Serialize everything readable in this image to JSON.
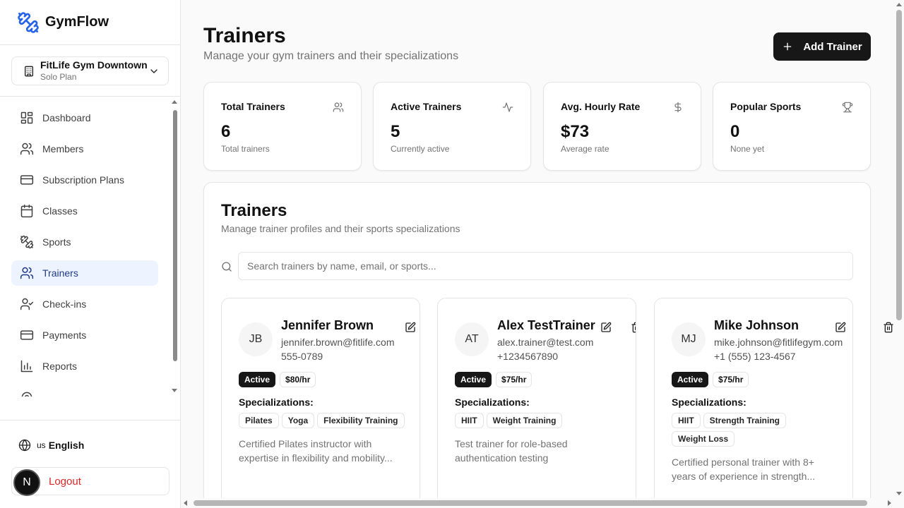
{
  "app": {
    "name": "GymFlow"
  },
  "gym_selector": {
    "name": "FitLife Gym Downtown",
    "plan": "Solo Plan"
  },
  "sidebar": {
    "items": [
      {
        "label": "Dashboard",
        "icon": "dashboard-icon"
      },
      {
        "label": "Members",
        "icon": "users-icon"
      },
      {
        "label": "Subscription Plans",
        "icon": "credit-card-icon"
      },
      {
        "label": "Classes",
        "icon": "calendar-icon"
      },
      {
        "label": "Sports",
        "icon": "dumbbell-icon"
      },
      {
        "label": "Trainers",
        "icon": "users-icon",
        "active": true
      },
      {
        "label": "Check-ins",
        "icon": "user-check-icon"
      },
      {
        "label": "Payments",
        "icon": "credit-card-icon"
      },
      {
        "label": "Reports",
        "icon": "bar-chart-icon"
      }
    ],
    "language": {
      "code": "us",
      "name": "English"
    },
    "logout_label": "Logout",
    "avatar_initial": "N"
  },
  "header": {
    "title": "Trainers",
    "subtitle": "Manage your gym trainers and their specializations",
    "add_button_label": "Add Trainer"
  },
  "stats": [
    {
      "title": "Total Trainers",
      "value": "6",
      "desc": "Total trainers",
      "icon": "users-icon"
    },
    {
      "title": "Active Trainers",
      "value": "5",
      "desc": "Currently active",
      "icon": "activity-icon"
    },
    {
      "title": "Avg. Hourly Rate",
      "value": "$73",
      "desc": "Average rate",
      "icon": "dollar-icon"
    },
    {
      "title": "Popular Sports",
      "value": "0",
      "desc": "None yet",
      "icon": "trophy-icon"
    }
  ],
  "panel": {
    "title": "Trainers",
    "subtitle": "Manage trainer profiles and their sports specializations",
    "search_placeholder": "Search trainers by name, email, or sports..."
  },
  "trainers": [
    {
      "initials": "JB",
      "name": "Jennifer Brown",
      "email": "jennifer.brown@fitlife.com",
      "phone": "555-0789",
      "status": "Active",
      "rate": "$80/hr",
      "specializations_label": "Specializations:",
      "specializations": [
        "Pilates",
        "Yoga",
        "Flexibility Training"
      ],
      "description_l1": "Certified Pilates instructor with",
      "description_l2": "expertise in flexibility and mobility..."
    },
    {
      "initials": "AT",
      "name": "Alex TestTrainer",
      "email": "alex.trainer@test.com",
      "phone": "+1234567890",
      "status": "Active",
      "rate": "$75/hr",
      "specializations_label": "Specializations:",
      "specializations": [
        "HIIT",
        "Weight Training"
      ],
      "description_l1": "Test trainer for role-based",
      "description_l2": "authentication testing"
    },
    {
      "initials": "MJ",
      "name": "Mike Johnson",
      "email": "mike.johnson@fitlifegym.com",
      "phone": "+1 (555) 123-4567",
      "status": "Active",
      "rate": "$75/hr",
      "specializations_label": "Specializations:",
      "specializations": [
        "HIIT",
        "Strength Training",
        "Weight Loss"
      ],
      "description_l1": "Certified personal trainer with 8+",
      "description_l2": "years of experience in strength..."
    }
  ],
  "colors": {
    "accent": "#2563eb",
    "active_nav_bg": "#eef4ff",
    "primary_button": "#171717",
    "danger": "#dc2626"
  }
}
